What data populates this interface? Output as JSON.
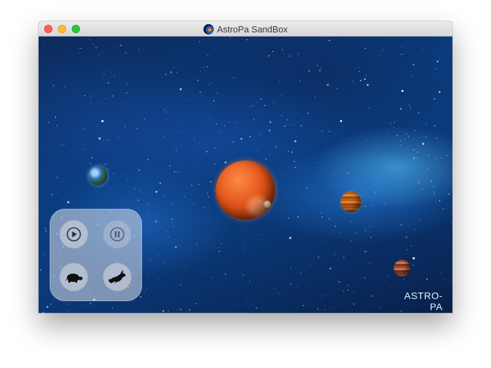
{
  "window": {
    "title": "AstroPa SandBox",
    "controls": [
      "close",
      "minimize",
      "zoom"
    ]
  },
  "scene": {
    "watermark": "ASTRO-PA",
    "planets": [
      "earth-like planet",
      "jupiter-like planet",
      "small moon",
      "orange banded planet",
      "red banded planet"
    ]
  },
  "controls": {
    "play": {
      "icon": "play-icon",
      "enabled": true
    },
    "pause": {
      "icon": "pause-icon",
      "enabled": false
    },
    "slower": {
      "icon": "turtle-icon"
    },
    "faster": {
      "icon": "rabbit-icon"
    }
  },
  "colors": {
    "close": "#fe5f57",
    "minimize": "#febc2e",
    "zoom": "#28c840",
    "space": "#0a3d80"
  }
}
